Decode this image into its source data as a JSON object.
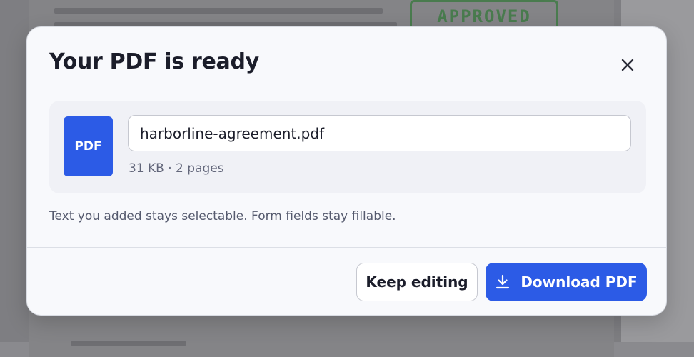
{
  "background": {
    "stamp_text": "APPROVED"
  },
  "dialog": {
    "title": "Your PDF is ready",
    "close_icon": "close-icon",
    "file": {
      "badge": "PDF",
      "filename": "harborline-agreement.pdf",
      "meta": "31  KB · 2 pages"
    },
    "note": "Text you added stays selectable. Form fields stay fillable.",
    "actions": {
      "keep_editing_label": "Keep editing",
      "download_label": "Download PDF",
      "download_icon": "download-icon"
    }
  },
  "colors": {
    "accent": "#2c5be6",
    "title": "#1b1d2a",
    "muted": "#62667a"
  }
}
